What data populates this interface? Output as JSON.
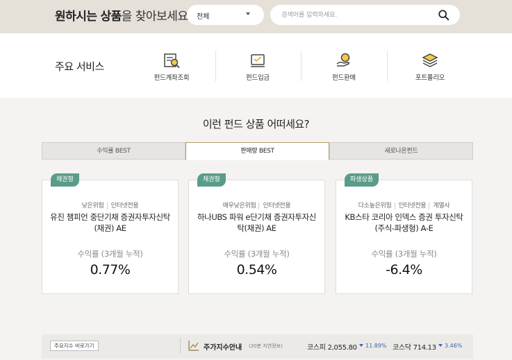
{
  "search": {
    "title_bold_1": "원하시는",
    "title_bold_2": "상품",
    "title_rest": "을 찾아보세요.",
    "category_value": "전체",
    "placeholder": "검색어를 입력하세요."
  },
  "services": {
    "title": "주요 서비스",
    "items": [
      {
        "label": "펀드계좌조회",
        "icon": "account-inquiry-icon"
      },
      {
        "label": "펀드입금",
        "icon": "deposit-icon"
      },
      {
        "label": "펀드환매",
        "icon": "redemption-icon"
      },
      {
        "label": "포트폴리오",
        "icon": "portfolio-icon"
      }
    ]
  },
  "recommend": {
    "title": "이런 펀드 상품 어떠세요?",
    "tabs": [
      {
        "label": "수익률 BEST",
        "active": false
      },
      {
        "label": "판매량 BEST",
        "active": true
      },
      {
        "label": "새로나온펀드",
        "active": false
      }
    ],
    "funds": [
      {
        "badge": "채권형",
        "tags": [
          "낮은위험",
          "인터넷전용"
        ],
        "name": "유진 챔피언 중단기채 증권자투자신탁(채권) AE",
        "rate_label": "수익률 (3개월 누적)",
        "rate": "0.77%"
      },
      {
        "badge": "채권형",
        "tags": [
          "매우낮은위험",
          "인터넷전용"
        ],
        "name": "하나UBS 파워 e단기채 증권자투자신탁(채권) AE",
        "rate_label": "수익률 (3개월 누적)",
        "rate": "0.54%"
      },
      {
        "badge": "파생상품",
        "tags": [
          "다소높은위험",
          "인터넷전용",
          "계열사"
        ],
        "name": "KB스타 코리아 인덱스 증권 투자신탁(주식-파생형) A-E",
        "rate_label": "수익률 (3개월 누적)",
        "rate": "-6.4%"
      }
    ]
  },
  "index": {
    "shortcut_label": "주요지수 바로가기",
    "title": "주가지수안내",
    "subtitle": "(20분 지연정보)",
    "items": [
      {
        "name": "코스피",
        "value": "2,055.80",
        "change": "11.89%"
      },
      {
        "name": "코스닥",
        "value": "714.13",
        "change": "3.46%"
      }
    ]
  },
  "colors": {
    "search_bg": "#e5e1d9",
    "badge": "#5a9c8a",
    "active_tab_border": "#b39a6a",
    "down": "#3d63b8",
    "icon_accent": "#f2c94c"
  }
}
